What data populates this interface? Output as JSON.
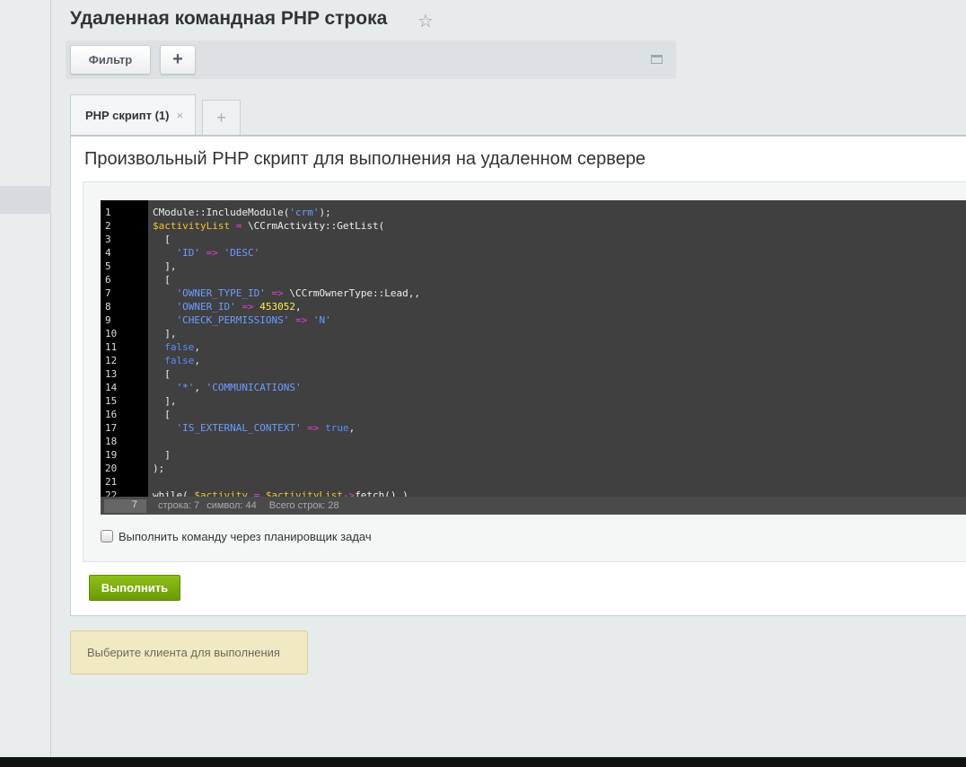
{
  "page": {
    "title": "Удаленная командная PHP строка",
    "favorite_icon": "star-icon"
  },
  "filter": {
    "filter_label": "Фильтр",
    "add_label": "+"
  },
  "tabs": [
    {
      "label": "PHP скрипт (1)",
      "close": "×"
    },
    {
      "label": "+"
    }
  ],
  "panel": {
    "heading": "Произвольный PHP скрипт для выполнения на удаленном сервере"
  },
  "editor": {
    "lines": [
      [
        [
          "def",
          "CModule::IncludeModule("
        ],
        [
          "str",
          "'crm'"
        ],
        [
          "def",
          ");"
        ]
      ],
      [
        [
          "var",
          "$activityList"
        ],
        [
          "op",
          " = "
        ],
        [
          "def",
          "\\CCrmActivity::GetList("
        ]
      ],
      [
        [
          "def",
          "  ["
        ]
      ],
      [
        [
          "str",
          "    'ID'"
        ],
        [
          "op",
          " => "
        ],
        [
          "str",
          "'DESC'"
        ]
      ],
      [
        [
          "def",
          "  ],"
        ]
      ],
      [
        [
          "def",
          "  ["
        ]
      ],
      [
        [
          "str",
          "    'OWNER_TYPE_ID'"
        ],
        [
          "op",
          " => "
        ],
        [
          "def",
          "\\CCrmOwnerType::Lead,,"
        ]
      ],
      [
        [
          "str",
          "    'OWNER_ID'"
        ],
        [
          "op",
          " => "
        ],
        [
          "num",
          "453052"
        ],
        [
          "def",
          ","
        ]
      ],
      [
        [
          "str",
          "    'CHECK_PERMISSIONS'"
        ],
        [
          "op",
          " => "
        ],
        [
          "str",
          "'N'"
        ]
      ],
      [
        [
          "def",
          "  ],"
        ]
      ],
      [
        [
          "kw",
          "  false"
        ],
        [
          "def",
          ","
        ]
      ],
      [
        [
          "kw",
          "  false"
        ],
        [
          "def",
          ","
        ]
      ],
      [
        [
          "def",
          "  ["
        ]
      ],
      [
        [
          "str",
          "    '*'"
        ],
        [
          "def",
          ", "
        ],
        [
          "str",
          "'COMMUNICATIONS'"
        ]
      ],
      [
        [
          "def",
          "  ],"
        ]
      ],
      [
        [
          "def",
          "  ["
        ]
      ],
      [
        [
          "str",
          "    'IS_EXTERNAL_CONTEXT'"
        ],
        [
          "op",
          " => "
        ],
        [
          "kw",
          "true"
        ],
        [
          "def",
          ","
        ]
      ],
      [
        [
          "def",
          ""
        ]
      ],
      [
        [
          "def",
          "  ]"
        ]
      ],
      [
        [
          "def",
          ");"
        ]
      ],
      [
        [
          "def",
          ""
        ]
      ],
      [
        [
          "def",
          "while( "
        ],
        [
          "var",
          "$activity"
        ],
        [
          "op",
          " = "
        ],
        [
          "var",
          "$activityList"
        ],
        [
          "op",
          "->"
        ],
        [
          "def",
          "fetch() )"
        ]
      ]
    ],
    "goto_line": "7",
    "status_line": "строка: 7",
    "status_char": "символ: 44",
    "status_total": "Всего строк: 28"
  },
  "options": {
    "scheduler_label": "Выполнить команду через планировщик задач",
    "scheduler_checked": false
  },
  "actions": {
    "run_label": "Выполнить"
  },
  "notice": {
    "text": "Выберите клиента для выполнения"
  },
  "colors": {
    "run_button": "#7aab0e",
    "editor_bg": "#404040",
    "string": "#6f9bff",
    "operator": "#e040d0",
    "variable": "#f1c232"
  }
}
